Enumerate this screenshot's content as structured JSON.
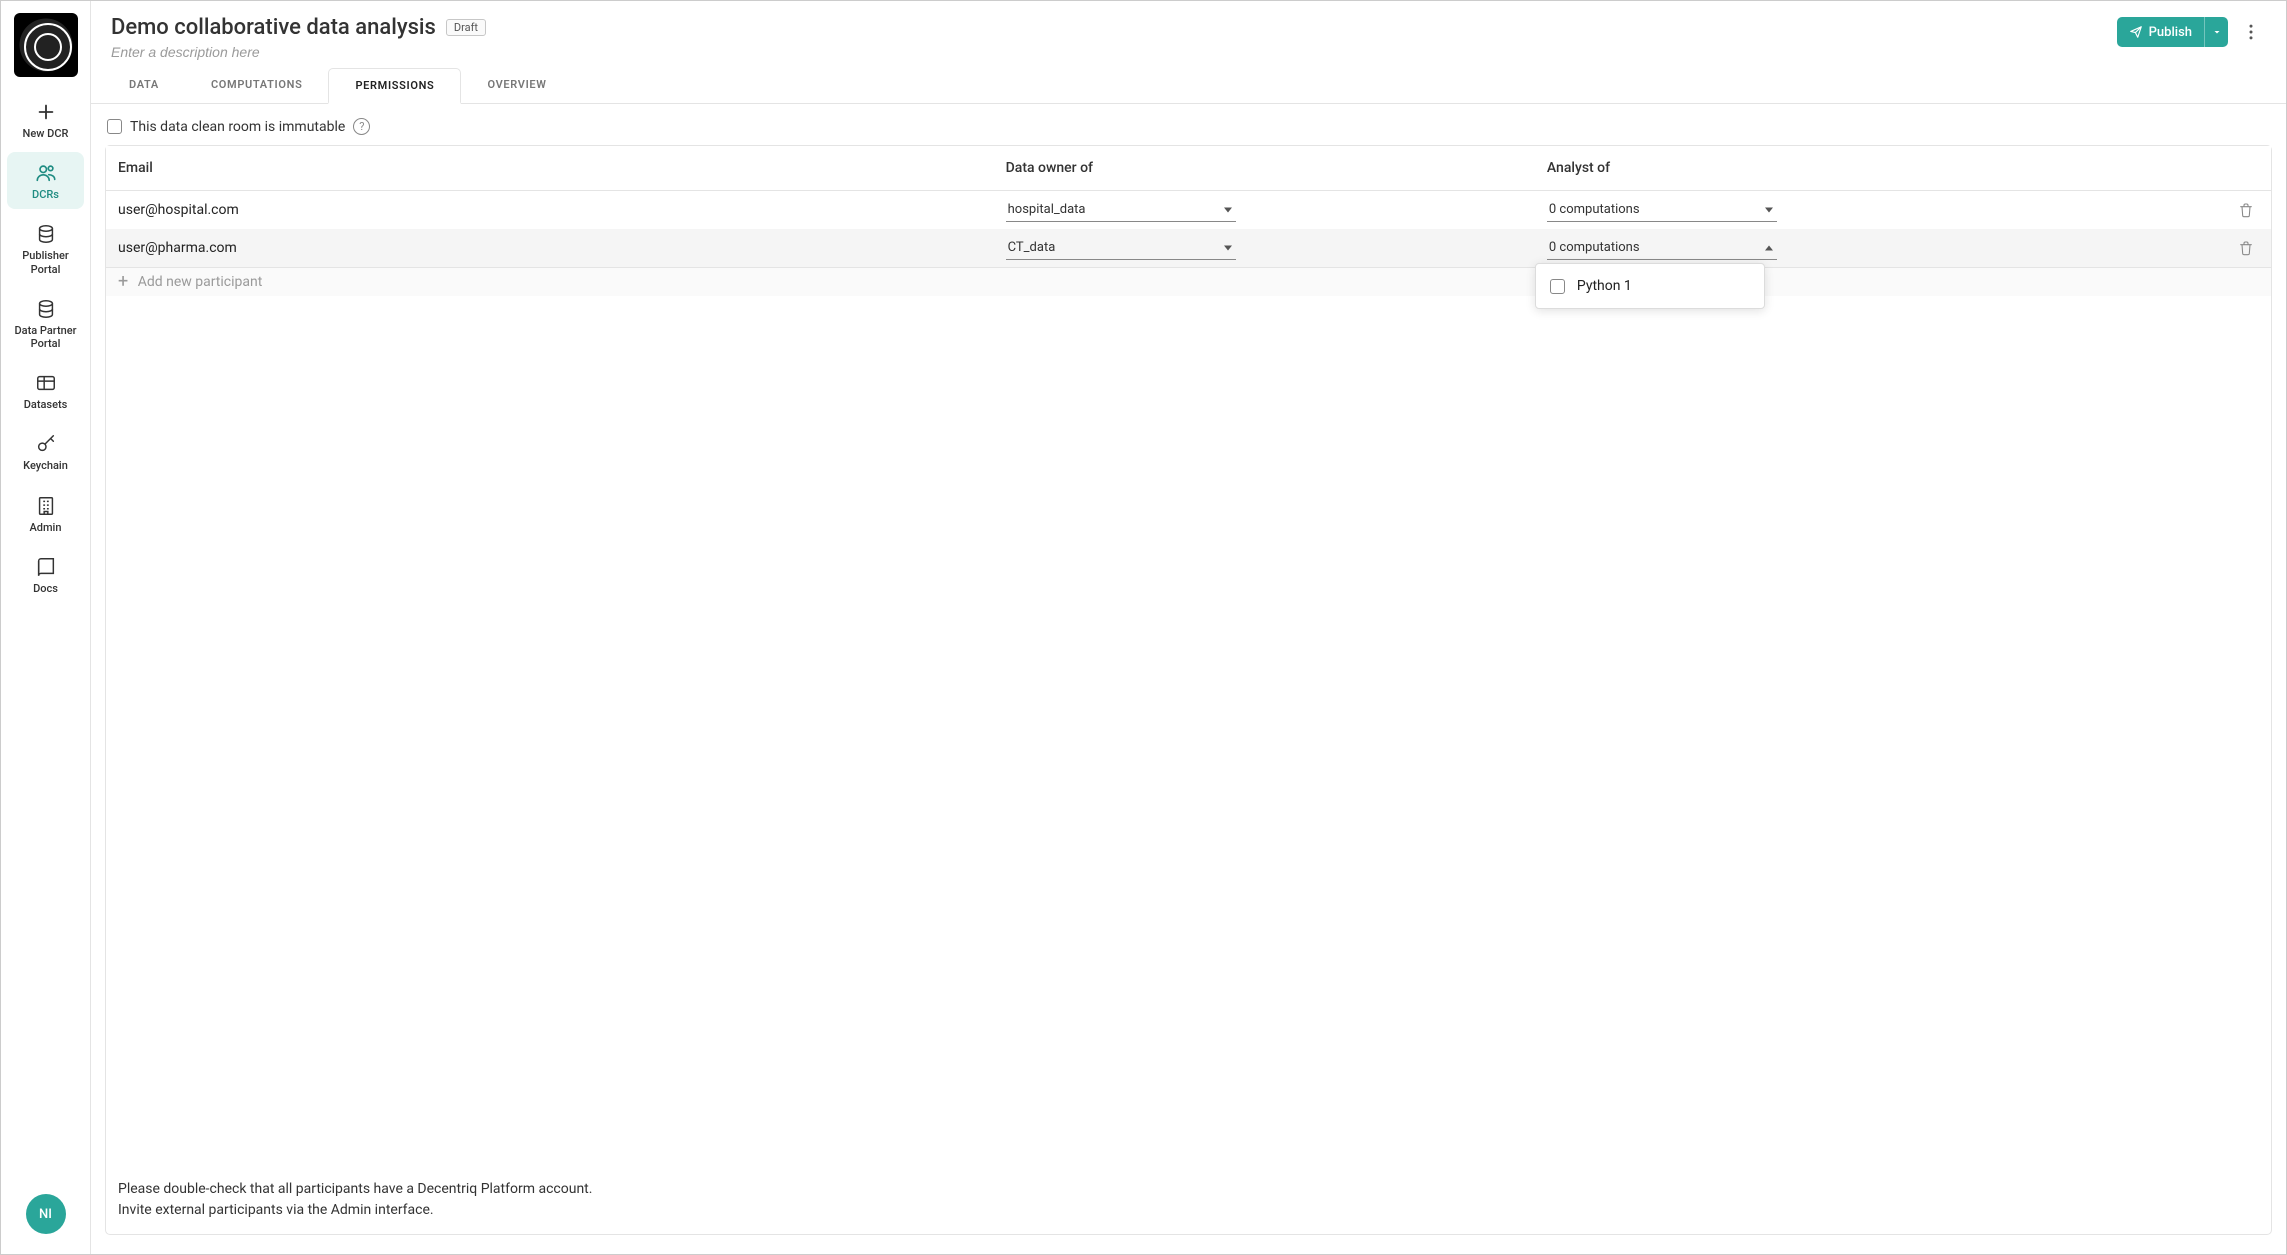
{
  "sidebar": {
    "logo_alt": "App logo",
    "items": [
      {
        "id": "new-dcr",
        "label": "New DCR",
        "icon": "plus-icon"
      },
      {
        "id": "dcrs",
        "label": "DCRs",
        "icon": "users-icon",
        "active": true
      },
      {
        "id": "pub",
        "label": "Publisher Portal",
        "icon": "database-icon"
      },
      {
        "id": "dpp",
        "label": "Data Partner Portal",
        "icon": "database-icon"
      },
      {
        "id": "datasets",
        "label": "Datasets",
        "icon": "table-icon"
      },
      {
        "id": "keychain",
        "label": "Keychain",
        "icon": "key-icon"
      },
      {
        "id": "admin",
        "label": "Admin",
        "icon": "building-icon"
      },
      {
        "id": "docs",
        "label": "Docs",
        "icon": "book-icon"
      }
    ],
    "avatar_initials": "NI"
  },
  "header": {
    "title": "Demo collaborative data analysis",
    "badge": "Draft",
    "description_placeholder": "Enter a description here",
    "publish_label": "Publish"
  },
  "tabs": [
    {
      "id": "data",
      "label": "DATA"
    },
    {
      "id": "computations",
      "label": "COMPUTATIONS"
    },
    {
      "id": "permissions",
      "label": "PERMISSIONS",
      "active": true
    },
    {
      "id": "overview",
      "label": "OVERVIEW"
    }
  ],
  "permissions": {
    "immutable_label": "This data clean room is immutable",
    "columns": {
      "email": "Email",
      "owner": "Data owner of",
      "analyst": "Analyst of"
    },
    "rows": [
      {
        "email": "user@hospital.com",
        "owner": "hospital_data",
        "analyst": "0 computations"
      },
      {
        "email": "user@pharma.com",
        "owner": "CT_data",
        "analyst": "0 computations",
        "analyst_open": true
      }
    ],
    "add_label": "Add new participant",
    "dropdown": {
      "options": [
        {
          "label": "Python 1",
          "checked": false
        }
      ]
    },
    "footer_line1": "Please double-check that all participants have a Decentriq Platform account.",
    "footer_line2": "Invite external participants via the Admin interface."
  }
}
